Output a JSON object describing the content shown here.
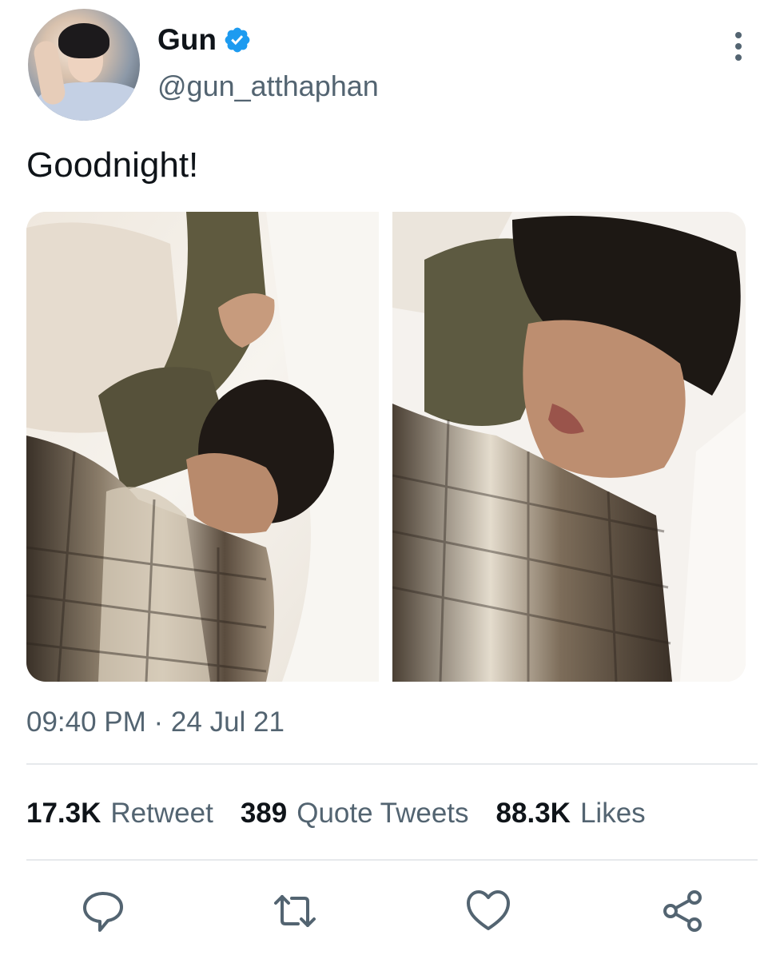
{
  "tweet": {
    "author": {
      "display_name": "Gun",
      "handle": "@gun_atthaphan",
      "verified": true
    },
    "text": "Goodnight!",
    "timestamp": "09:40 PM · 24 Jul 21",
    "stats": [
      {
        "value": "17.3K",
        "label": "Retweet"
      },
      {
        "value": "389",
        "label": "Quote Tweets"
      },
      {
        "value": "88.3K",
        "label": "Likes"
      }
    ],
    "actions": [
      "reply-icon",
      "retweet-icon",
      "like-icon",
      "share-icon"
    ],
    "media_count": 2
  },
  "colors": {
    "text_primary": "#0f1419",
    "text_secondary": "#536471",
    "verified_blue": "#1d9bf0",
    "divider": "#e6e9ec"
  }
}
